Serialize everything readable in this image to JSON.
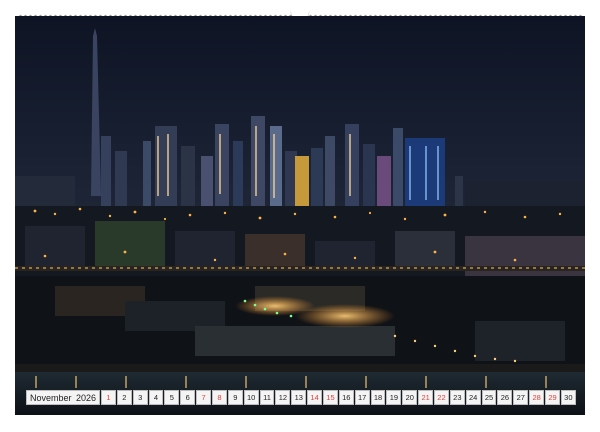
{
  "calendar": {
    "month": "November",
    "year": "2026",
    "days": [
      "1",
      "2",
      "3",
      "4",
      "5",
      "6",
      "7",
      "8",
      "9",
      "10",
      "11",
      "12",
      "13",
      "14",
      "15",
      "16",
      "17",
      "18",
      "19",
      "20",
      "21",
      "22",
      "23",
      "24",
      "25",
      "26",
      "27",
      "28",
      "29",
      "30"
    ],
    "weekend_days": [
      1,
      7,
      8,
      14,
      15,
      21,
      22,
      28,
      29
    ],
    "weekend_color": "#e0413a"
  },
  "photo": {
    "subject": "night city skyline",
    "sky_color": "#141a2a",
    "light_color": "#ffb347"
  }
}
